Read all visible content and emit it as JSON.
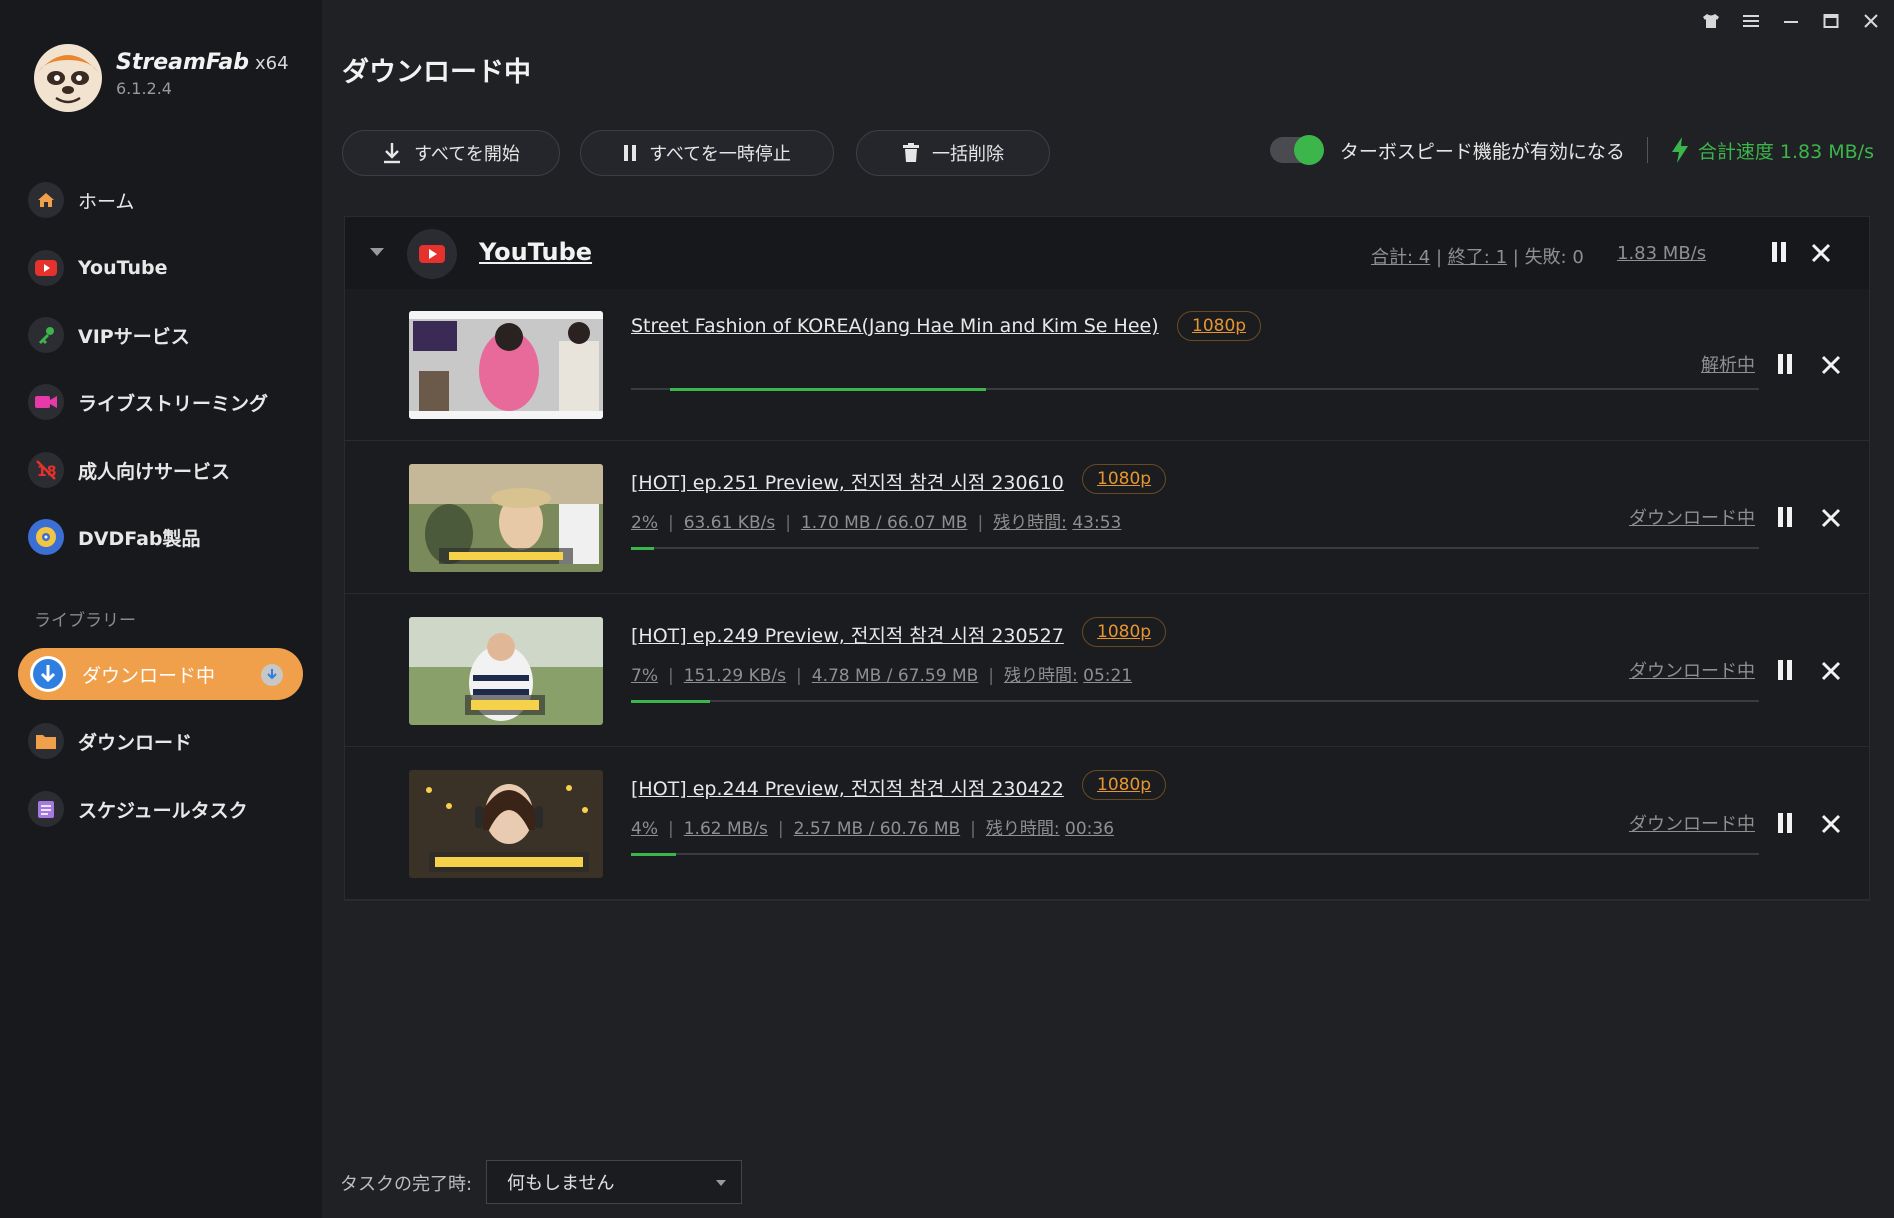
{
  "app": {
    "name": "StreamFab",
    "arch": "x64",
    "version": "6.1.2.4"
  },
  "sidebar": {
    "items": [
      {
        "label": "ホーム",
        "icon": "home-icon"
      },
      {
        "label": "YouTube",
        "icon": "youtube-icon"
      },
      {
        "label": "VIPサービス",
        "icon": "key-icon"
      },
      {
        "label": "ライブストリーミング",
        "icon": "camera-icon"
      },
      {
        "label": "成人向けサービス",
        "icon": "adult-icon"
      },
      {
        "label": "DVDFab製品",
        "icon": "dvdfab-icon"
      }
    ],
    "library_label": "ライブラリー",
    "library_items": [
      {
        "label": "ダウンロード中",
        "icon": "download-arrow-icon",
        "active": true
      },
      {
        "label": "ダウンロード",
        "icon": "folder-icon"
      },
      {
        "label": "スケジュールタスク",
        "icon": "schedule-icon"
      }
    ]
  },
  "header": {
    "title": "ダウンロード中"
  },
  "toolbar": {
    "start_all": "すべてを開始",
    "pause_all": "すべてを一時停止",
    "delete_all": "一括削除",
    "turbo_label": "ターボスピード機能が有効になる",
    "total_speed": "合計速度 1.83 MB/s"
  },
  "group": {
    "title": "YouTube",
    "total": "合計: 4",
    "finished": "終了: 1",
    "failed": "失敗: 0",
    "speed": "1.83 MB/s"
  },
  "tasks": [
    {
      "title": "Street Fashion of KOREA(Jang Hae Min and Kim Se Hee)",
      "resolution": "1080p",
      "status": "解析中",
      "progress_start": 0.035,
      "progress_fill": 0.28
    },
    {
      "title": "[HOT] ep.251 Preview, 전지적 참견 시점 230610",
      "resolution": "1080p",
      "percent": "2%",
      "speed": "63.61 KB/s",
      "size": "1.70 MB / 66.07 MB",
      "remaining_label": "残り時間:",
      "remaining": "43:53",
      "status": "ダウンロード中",
      "progress_start": 0,
      "progress_fill": 0.02
    },
    {
      "title": "[HOT] ep.249 Preview, 전지적 참견 시점 230527",
      "resolution": "1080p",
      "percent": "7%",
      "speed": "151.29 KB/s",
      "size": "4.78 MB / 67.59 MB",
      "remaining_label": "残り時間:",
      "remaining": "05:21",
      "status": "ダウンロード中",
      "progress_start": 0,
      "progress_fill": 0.07
    },
    {
      "title": "[HOT] ep.244 Preview, 전지적 참견 시점 230422",
      "resolution": "1080p",
      "percent": "4%",
      "speed": "1.62 MB/s",
      "size": "2.57 MB / 60.76 MB",
      "remaining_label": "残り時間:",
      "remaining": "00:36",
      "status": "ダウンロード中",
      "progress_start": 0,
      "progress_fill": 0.04
    }
  ],
  "footer": {
    "label": "タスクの完了時:",
    "selected": "何もしません"
  },
  "colors": {
    "accent": "#f0a04b",
    "green": "#3cb54a",
    "badge": "#e6962f"
  }
}
